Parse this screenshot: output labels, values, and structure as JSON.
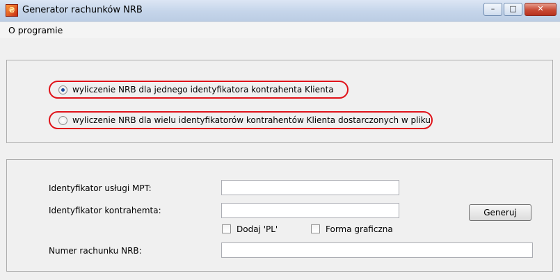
{
  "window": {
    "title": "Generator rachunków NRB",
    "min_glyph": "–",
    "max_glyph": "□",
    "close_glyph": "✕"
  },
  "menu": {
    "about": "O programie"
  },
  "mode": {
    "options": [
      {
        "label": "wyliczenie NRB dla jednego identyfikatora kontrahenta Klienta",
        "checked": true
      },
      {
        "label": "wyliczenie NRB dla wielu identyfikatorów kontrahentów Klienta dostarczonych w pliku",
        "checked": false
      }
    ]
  },
  "form": {
    "service_id_label": "Identyfikator usługi MPT:",
    "service_id_value": "",
    "contractor_id_label": "Identyfikator kontrahemta:",
    "contractor_id_value": "",
    "add_pl_label": "Dodaj 'PL'",
    "add_pl_checked": false,
    "graphic_form_label": "Forma graficzna",
    "graphic_form_checked": false,
    "nrb_number_label": "Numer rachunku NRB:",
    "nrb_number_value": "",
    "generate_label": "Generuj"
  },
  "colors": {
    "highlight": "#e0131a",
    "radio_selected": "#1d4d9c",
    "window_bg": "#f0f0f0"
  }
}
